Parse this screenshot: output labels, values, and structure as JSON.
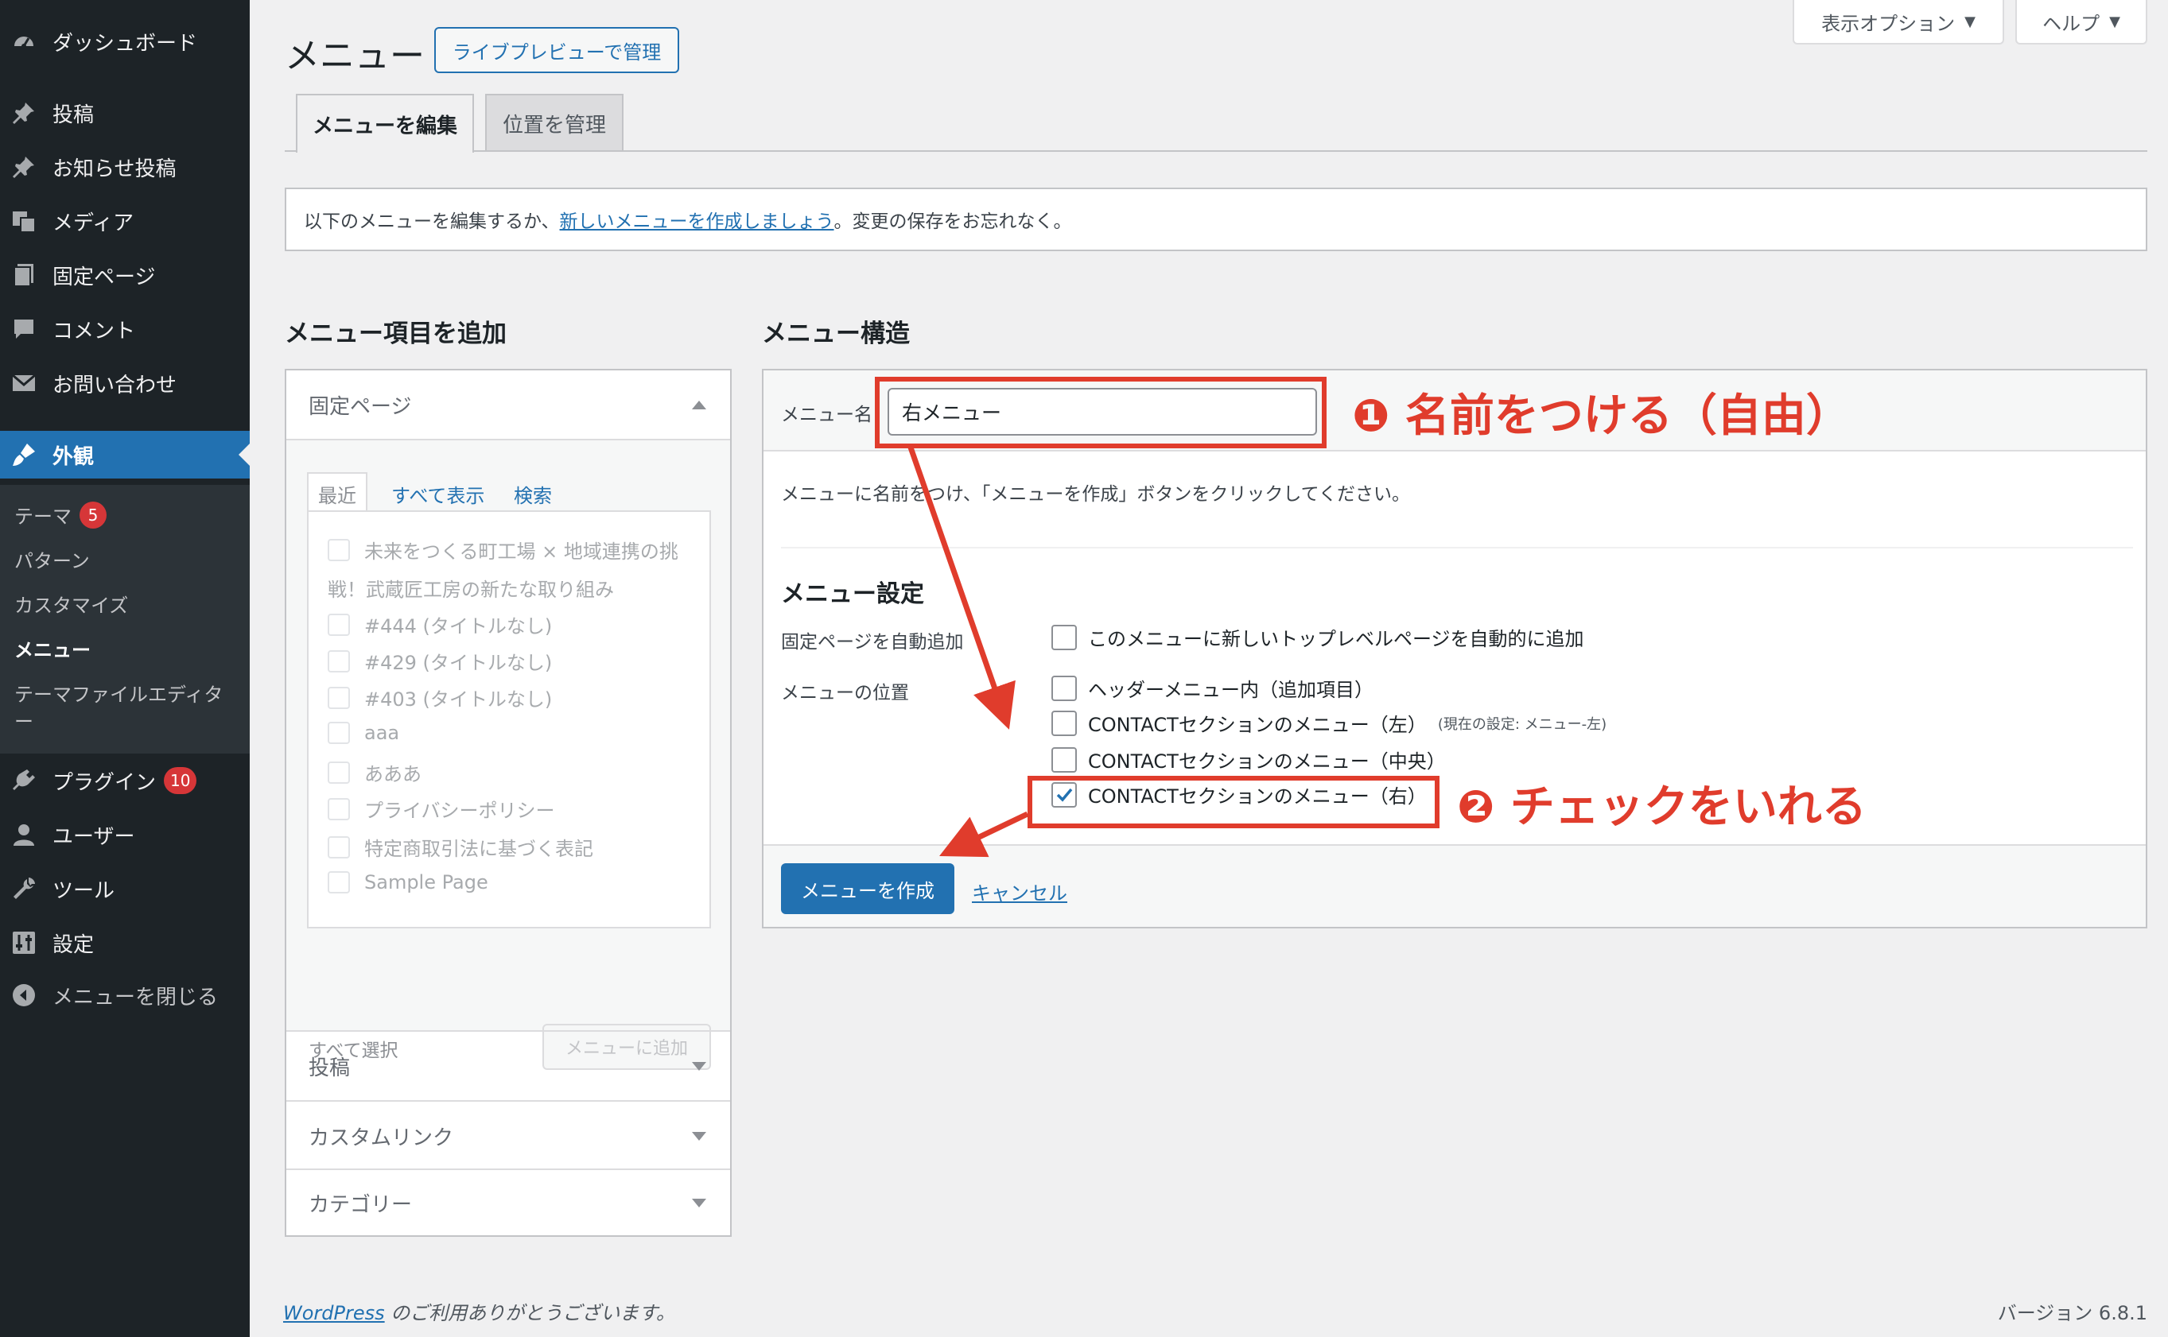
{
  "sidebar": {
    "items": [
      {
        "label": "ダッシュボード",
        "icon": "dashboard-icon"
      },
      {
        "label": "投稿",
        "icon": "pin-icon"
      },
      {
        "label": "お知らせ投稿",
        "icon": "pin-icon"
      },
      {
        "label": "メディア",
        "icon": "media-icon"
      },
      {
        "label": "固定ページ",
        "icon": "pages-icon"
      },
      {
        "label": "コメント",
        "icon": "comment-icon"
      },
      {
        "label": "お問い合わせ",
        "icon": "mail-icon"
      },
      {
        "label": "外観",
        "icon": "appearance-icon"
      },
      {
        "label": "プラグイン",
        "icon": "plugin-icon",
        "badge": "10"
      },
      {
        "label": "ユーザー",
        "icon": "user-icon"
      },
      {
        "label": "ツール",
        "icon": "wrench-icon"
      },
      {
        "label": "設定",
        "icon": "settings-icon"
      },
      {
        "label": "メニューを閉じる",
        "icon": "collapse-icon"
      }
    ],
    "submenu": [
      {
        "label": "テーマ",
        "badge": "5"
      },
      {
        "label": "パターン"
      },
      {
        "label": "カスタマイズ"
      },
      {
        "label": "メニュー"
      },
      {
        "label": "テーマファイルエディタ"
      },
      {
        "label": "ー"
      }
    ]
  },
  "top": {
    "screen_options": "表示オプション",
    "help": "ヘルプ",
    "title": "メニュー",
    "live_preview": "ライブプレビューで管理"
  },
  "tabs": [
    {
      "label": "メニューを編集"
    },
    {
      "label": "位置を管理"
    }
  ],
  "notice": {
    "before": "以下のメニューを編集するか、",
    "link": "新しいメニューを作成しましょう",
    "after": "。変更の保存をお忘れなく。"
  },
  "left": {
    "heading": "メニュー項目を追加",
    "pages_section": "固定ページ",
    "inner_tabs": [
      "最近",
      "すべて表示",
      "検索"
    ],
    "pages": [
      "未来をつくる町工場 × 地域連携の挑",
      "戦！武蔵匠工房の新たな取り組み",
      "#444 (タイトルなし)",
      "#429 (タイトルなし)",
      "#403 (タイトルなし)",
      "aaa",
      "あああ",
      "プライバシーポリシー",
      "特定商取引法に基づく表記",
      "Sample Page"
    ],
    "select_all": "すべて選択",
    "add_to_menu": "メニューに追加",
    "sections": [
      "投稿",
      "カスタムリンク",
      "カテゴリー"
    ]
  },
  "right": {
    "heading": "メニュー構造",
    "menu_name_label": "メニュー名",
    "menu_name_value": "右メニュー",
    "instruction": "メニューに名前をつけ、「メニューを作成」ボタンをクリックしてください。",
    "settings_heading": "メニュー設定",
    "auto_add_label": "固定ページを自動追加",
    "auto_add_option": "このメニューに新しいトップレベルページを自動的に追加",
    "location_label": "メニューの位置",
    "locations": [
      {
        "label": "ヘッダーメニュー内（追加項目）",
        "checked": false,
        "note": ""
      },
      {
        "label": "CONTACTセクションのメニュー（左）",
        "checked": false,
        "note": "(現在の設定: メニュー-左)"
      },
      {
        "label": "CONTACTセクションのメニュー（中央）",
        "checked": false,
        "note": ""
      },
      {
        "label": "CONTACTセクションのメニュー（右）",
        "checked": true,
        "note": ""
      }
    ],
    "create_button": "メニューを作成",
    "cancel": "キャンセル"
  },
  "annotations": {
    "step1": "❶ 名前をつける（自由）",
    "step2": "❷ チェックをいれる",
    "color": "#e03c2c"
  },
  "footer": {
    "wp_link": "WordPress",
    "thanks": " のご利用ありがとうございます。",
    "version": "バージョン 6.8.1"
  }
}
